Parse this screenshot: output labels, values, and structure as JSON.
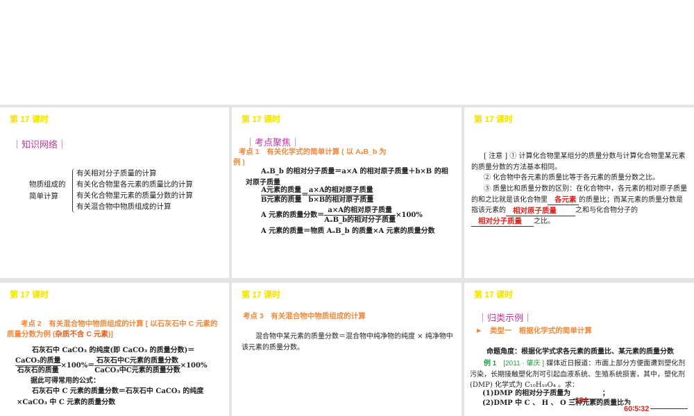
{
  "lesson_title": "第 17 课时",
  "slide1": {
    "section": "｜知识网络｜",
    "root_line1": "物质组成的",
    "root_line2": "简单计算",
    "items": [
      "有关相对分子质量的计算",
      "有关化合物里各元素的质量比的计算",
      "有关化合物里元素的质量分数的计算",
      "有关混合物中物质组成的计算"
    ]
  },
  "slide2": {
    "section": "｜考点聚焦｜",
    "heading": "考点 1　有关化学式的简单计算 ( 以 AₐB_b 为例 )",
    "l1": "AₐB_b 的相对分子质量＝a×A 的相对原子质量＋b×B 的相对原子质量",
    "f1_num_l": "A元素的质量",
    "f1_den_l": "B元素的质量",
    "f1_num_r": "a×A的相对原子质量",
    "f1_den_r": "b×B的相对原子质量",
    "f2_label": "A 元素的质量分数＝",
    "f2_num": "a×A的相对原子质量",
    "f2_den": "AₐB_b的相对分子质量",
    "f2_tail": "×100%",
    "l4": "A 元素的质量＝物质 AₐB_b 的质量×A 元素的质量分数"
  },
  "slide3": {
    "note1": "[ 注意 ] ① 计算化合物里某组分的质量分数与计算化合物里某元素的质量分数的方法基本相同。",
    "note2": "② 化合物中各元素的质量比等于各元素的质量分数之比。",
    "note3a": "③ 质量比和质量分数的区别：在化合物中，各元素的相对原子质量的和之比就是该化合物里",
    "ans1": "各元素",
    "note3b": "的质量比；而某元素的质量分数是指该元素的",
    "ans2": "相对原子质量",
    "note3c": "之和与化合物分子的",
    "ans3": "相对分子质量",
    "note3d": "之比。"
  },
  "slide4": {
    "heading": "考点 2　有关混合物中物质组成的计算 [ 以石灰石中 C 元素的质量分数为例 (",
    "heading_em": "杂质不含 C 元素",
    "heading_end": ")]",
    "l1": "石灰石中 CaCO₃ 的纯度(即 CaCO₃ 的质量分数)＝",
    "fa_num": "CaCO₃的质量",
    "fa_den": "石灰石的质量",
    "mid": "×100%＝",
    "fb_num": "石灰石中C元素的质量分数",
    "fb_den": "CaCO₃中C元素的质量分数",
    "tail": "×100%",
    "l3": "据此可得常用的公式：",
    "l4": "石灰石中 C 元素的质量分数＝石灰石中 CaCO₃ 的纯度×CaCO₃ 中 C 元素的质量分数"
  },
  "slide5": {
    "heading": "考点 3　有关混合物中物质组成的计算",
    "body": "混合物中某元素的质量分数＝混合物中纯净物的纯度 × 纯净物中该元素的质量分数。"
  },
  "slide6": {
    "section": "｜归类示例｜",
    "type_heading": "►　类型一　根据化学式的简单计算",
    "angle": "命题角度：根据化学式求各元素的质量比、某元素的质量分数",
    "example_label": "例 1",
    "example_src": "[2011 · 肇庆 ]",
    "example_text": "媒体近日报道：市面上部分方便面遭到塑化剂污染，长期接触塑化剂可引起血液系统、生殖系统损害，其中，塑化剂 (DMP) 化学式为 C₁₀H₁₀O₄ 。求：",
    "q1": "(1)DMP 的相对分子质量为",
    "q1_end": "；",
    "ans1": "194",
    "q2": "(2)DMP 中 C 、 H 、 O 三种元素的质量比为",
    "ans2": "60∶5∶32"
  }
}
